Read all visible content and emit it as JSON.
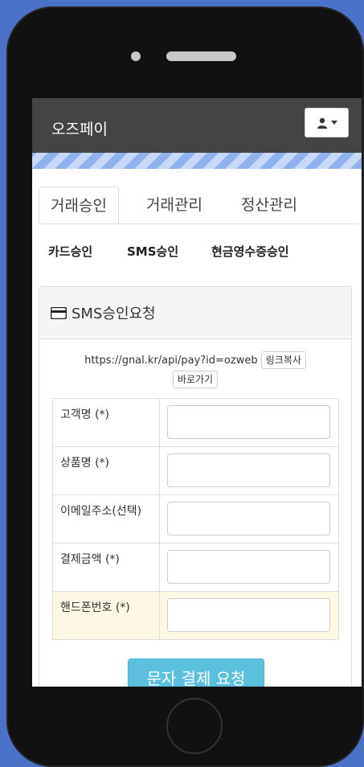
{
  "app": {
    "brand": "오즈페이"
  },
  "tabs": [
    {
      "label": "거래승인"
    },
    {
      "label": "거래관리"
    },
    {
      "label": "정산관리"
    }
  ],
  "subnav": [
    {
      "label": "카드승인"
    },
    {
      "label": "SMS승인"
    },
    {
      "label": "현금영수증승인"
    }
  ],
  "panel": {
    "title": "SMS승인요청",
    "icon": "credit-card-icon",
    "url": "https://gnal.kr/api/pay?id=ozweb",
    "copy_label": "링크복사",
    "shortcut_label": "바로가기"
  },
  "form": {
    "fields": [
      {
        "label": "고객명 (*)",
        "value": ""
      },
      {
        "label": "상품명 (*)",
        "value": ""
      },
      {
        "label": "이메일주소(선택)",
        "value": ""
      },
      {
        "label": "결제금액 (*)",
        "value": ""
      },
      {
        "label": "핸드폰번호 (*)",
        "value": ""
      }
    ],
    "submit_label": "문자 결제 요청"
  },
  "colors": {
    "background": "#4a72c9",
    "navbar": "#444444",
    "accent": "#5bc0de",
    "highlight_row": "#fcf8e3"
  }
}
